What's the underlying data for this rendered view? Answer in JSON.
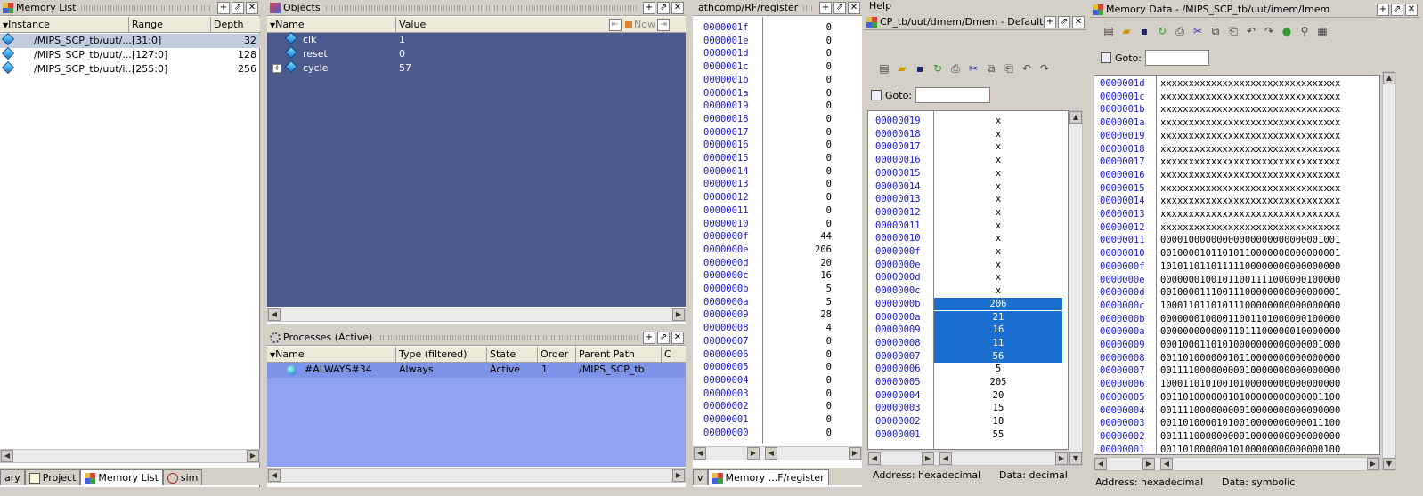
{
  "memory_list": {
    "title": "Memory List",
    "cols": [
      "Instance",
      "Range",
      "Depth"
    ],
    "rows": [
      {
        "instance": "/MIPS_SCP_tb/uut/...",
        "range": "[31:0]",
        "depth": "32"
      },
      {
        "instance": "/MIPS_SCP_tb/uut/...",
        "range": "[127:0]",
        "depth": "128"
      },
      {
        "instance": "/MIPS_SCP_tb/uut/i...",
        "range": "[255:0]",
        "depth": "256"
      }
    ]
  },
  "bottom_tabs": [
    {
      "label": "ary"
    },
    {
      "label": "Project"
    },
    {
      "label": "Memory List"
    },
    {
      "label": "sim"
    }
  ],
  "objects": {
    "title": "Objects",
    "cols": [
      "Name",
      "Value"
    ],
    "now_label": "Now",
    "rows": [
      {
        "name": "clk",
        "value": "1"
      },
      {
        "name": "reset",
        "value": "0"
      },
      {
        "name": "cycle",
        "value": "57"
      }
    ]
  },
  "processes": {
    "title": "Processes (Active)",
    "cols": [
      "Name",
      "Type (filtered)",
      "State",
      "Order",
      "Parent Path",
      "C"
    ],
    "rows": [
      {
        "name": "#ALWAYS#34",
        "type": "Always",
        "state": "Active",
        "order": "1",
        "parent": "/MIPS_SCP_tb"
      }
    ]
  },
  "rf": {
    "title": "athcomp/RF/register",
    "tabs": [
      "v",
      "Memory ...F/register"
    ],
    "rows": [
      [
        "0000001f",
        "0"
      ],
      [
        "0000001e",
        "0"
      ],
      [
        "0000001d",
        "0"
      ],
      [
        "0000001c",
        "0"
      ],
      [
        "0000001b",
        "0"
      ],
      [
        "0000001a",
        "0"
      ],
      [
        "00000019",
        "0"
      ],
      [
        "00000018",
        "0"
      ],
      [
        "00000017",
        "0"
      ],
      [
        "00000016",
        "0"
      ],
      [
        "00000015",
        "0"
      ],
      [
        "00000014",
        "0"
      ],
      [
        "00000013",
        "0"
      ],
      [
        "00000012",
        "0"
      ],
      [
        "00000011",
        "0"
      ],
      [
        "00000010",
        "0"
      ],
      [
        "0000000f",
        "44"
      ],
      [
        "0000000e",
        "206"
      ],
      [
        "0000000d",
        "20"
      ],
      [
        "0000000c",
        "16"
      ],
      [
        "0000000b",
        "5"
      ],
      [
        "0000000a",
        "5"
      ],
      [
        "00000009",
        "28"
      ],
      [
        "00000008",
        "4"
      ],
      [
        "00000007",
        "0"
      ],
      [
        "00000006",
        "0"
      ],
      [
        "00000005",
        "0"
      ],
      [
        "00000004",
        "0"
      ],
      [
        "00000003",
        "0"
      ],
      [
        "00000002",
        "0"
      ],
      [
        "00000001",
        "0"
      ],
      [
        "00000000",
        "0"
      ]
    ]
  },
  "dmem": {
    "menu": "Help",
    "title": "CP_tb/uut/dmem/Dmem - Default",
    "goto_label": "Goto:",
    "status_addr": "Address: hexadecimal",
    "status_data": "Data: decimal",
    "rows": [
      [
        "00000019",
        "x",
        false
      ],
      [
        "00000018",
        "x",
        false
      ],
      [
        "00000017",
        "x",
        false
      ],
      [
        "00000016",
        "x",
        false
      ],
      [
        "00000015",
        "x",
        false
      ],
      [
        "00000014",
        "x",
        false
      ],
      [
        "00000013",
        "x",
        false
      ],
      [
        "00000012",
        "x",
        false
      ],
      [
        "00000011",
        "x",
        false
      ],
      [
        "00000010",
        "x",
        false
      ],
      [
        "0000000f",
        "x",
        false
      ],
      [
        "0000000e",
        "x",
        false
      ],
      [
        "0000000d",
        "x",
        false
      ],
      [
        "0000000c",
        "x",
        false
      ],
      [
        "0000000b",
        "206",
        true
      ],
      [
        "0000000a",
        "21",
        true
      ],
      [
        "00000009",
        "16",
        true
      ],
      [
        "00000008",
        "11",
        true
      ],
      [
        "00000007",
        "56",
        true
      ],
      [
        "00000006",
        "5",
        false
      ],
      [
        "00000005",
        "205",
        false
      ],
      [
        "00000004",
        "20",
        false
      ],
      [
        "00000003",
        "15",
        false
      ],
      [
        "00000002",
        "10",
        false
      ],
      [
        "00000001",
        "55",
        false
      ]
    ]
  },
  "imem": {
    "title": "Memory Data - /MIPS_SCP_tb/uut/imem/Imem",
    "goto_label": "Goto:",
    "status_addr": "Address: hexadecimal",
    "status_data": "Data: symbolic",
    "rows": [
      [
        "0000001d",
        "xxxxxxxxxxxxxxxxxxxxxxxxxxxxxxxx"
      ],
      [
        "0000001c",
        "xxxxxxxxxxxxxxxxxxxxxxxxxxxxxxxx"
      ],
      [
        "0000001b",
        "xxxxxxxxxxxxxxxxxxxxxxxxxxxxxxxx"
      ],
      [
        "0000001a",
        "xxxxxxxxxxxxxxxxxxxxxxxxxxxxxxxx"
      ],
      [
        "00000019",
        "xxxxxxxxxxxxxxxxxxxxxxxxxxxxxxxx"
      ],
      [
        "00000018",
        "xxxxxxxxxxxxxxxxxxxxxxxxxxxxxxxx"
      ],
      [
        "00000017",
        "xxxxxxxxxxxxxxxxxxxxxxxxxxxxxxxx"
      ],
      [
        "00000016",
        "xxxxxxxxxxxxxxxxxxxxxxxxxxxxxxxx"
      ],
      [
        "00000015",
        "xxxxxxxxxxxxxxxxxxxxxxxxxxxxxxxx"
      ],
      [
        "00000014",
        "xxxxxxxxxxxxxxxxxxxxxxxxxxxxxxxx"
      ],
      [
        "00000013",
        "xxxxxxxxxxxxxxxxxxxxxxxxxxxxxxxx"
      ],
      [
        "00000012",
        "xxxxxxxxxxxxxxxxxxxxxxxxxxxxxxxx"
      ],
      [
        "00000011",
        "00001000000000000000000000001001"
      ],
      [
        "00000010",
        "00100001011010110000000000000001"
      ],
      [
        "0000000f",
        "10101101101111100000000000000000"
      ],
      [
        "0000000e",
        "00000001001011001111000000100000"
      ],
      [
        "0000000d",
        "00100001110011100000000000000001"
      ],
      [
        "0000000c",
        "10001101101011100000000000000000"
      ],
      [
        "0000000b",
        "00000001000011001101000000100000"
      ],
      [
        "0000000a",
        "00000000000011011100000010000000"
      ],
      [
        "00000009",
        "00010001101010000000000000001000"
      ],
      [
        "00000008",
        "00110100000010110000000000000000"
      ],
      [
        "00000007",
        "00111100000000010000000000000000"
      ],
      [
        "00000006",
        "10001101010010100000000000000000"
      ],
      [
        "00000005",
        "00110100000010100000000000001100"
      ],
      [
        "00000004",
        "00111100000000010000000000000000"
      ],
      [
        "00000003",
        "00110100001010010000000000011100"
      ],
      [
        "00000002",
        "00111100000000010000000000000000"
      ],
      [
        "00000001",
        "00110100000010100000000000000100"
      ]
    ]
  },
  "colors": {
    "objects_bg": "#4c5a8e",
    "process_sel": "#7d93e8",
    "process_bg": "#8ea2f0",
    "dmem_sel": "#1b6fd0",
    "mem_sel_row": "#c3cde0"
  }
}
